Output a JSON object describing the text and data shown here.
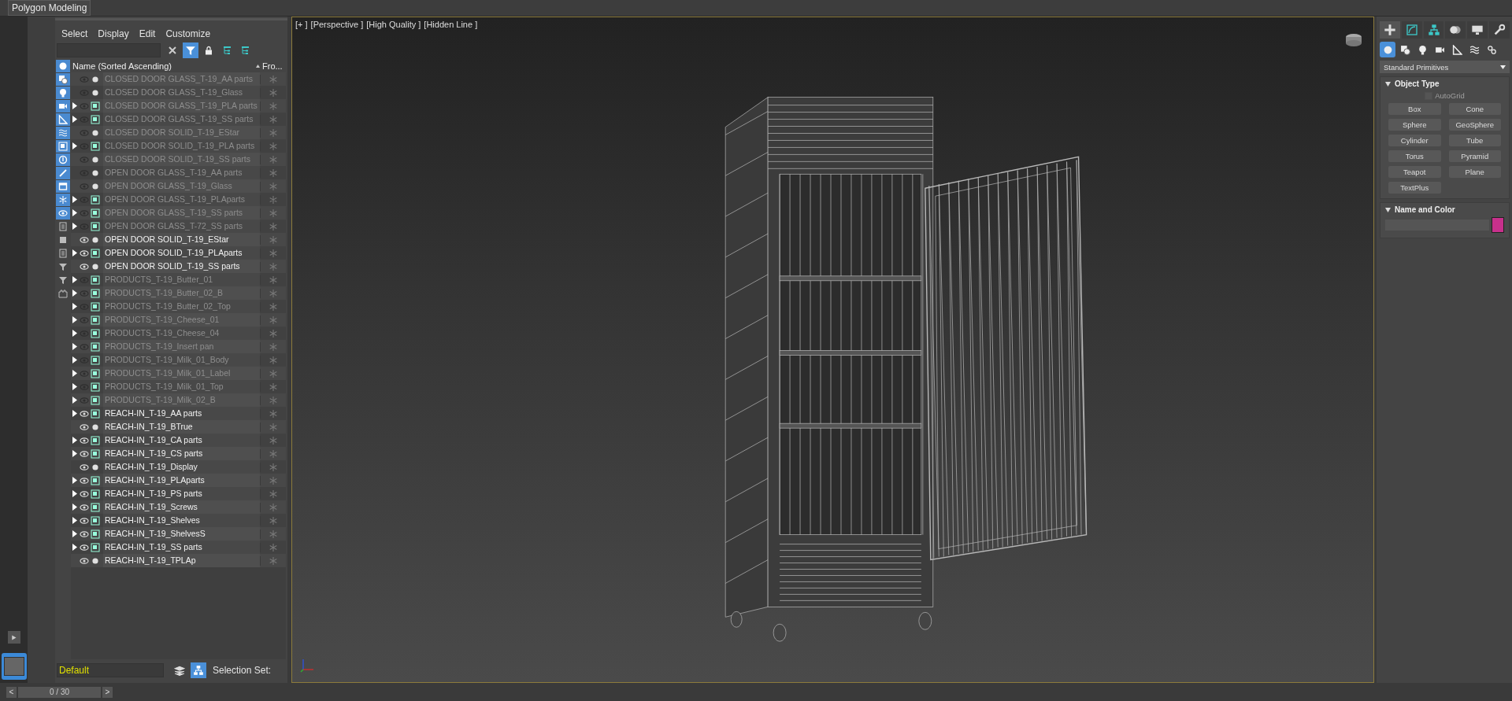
{
  "ribbon_tab": {
    "label": "Polygon Modeling"
  },
  "explorer": {
    "menu": [
      "Select",
      "Display",
      "Edit",
      "Customize"
    ],
    "filter_toggles": [
      {
        "on": true
      },
      {
        "on": true
      },
      {
        "on": true
      },
      {
        "on": true
      },
      {
        "on": true
      },
      {
        "on": true
      },
      {
        "on": true
      },
      {
        "on": true
      },
      {
        "on": true
      },
      {
        "on": true
      },
      {
        "on": true
      },
      {
        "on": true
      },
      {
        "on": false
      },
      {
        "on": false
      },
      {
        "on": false
      },
      {
        "on": false
      },
      {
        "on": false
      },
      {
        "on": false
      }
    ],
    "columns": [
      "Name (Sorted Ascending)",
      "Fro..."
    ],
    "rows": [
      {
        "name": "CLOSED DOOR GLASS_T-19_AA parts",
        "visible": false,
        "kind": "object",
        "expandable": false
      },
      {
        "name": "CLOSED DOOR GLASS_T-19_Glass",
        "visible": false,
        "kind": "object",
        "expandable": false
      },
      {
        "name": "CLOSED DOOR GLASS_T-19_PLA parts",
        "visible": false,
        "kind": "group",
        "expandable": true
      },
      {
        "name": "CLOSED DOOR GLASS_T-19_SS parts",
        "visible": false,
        "kind": "group",
        "expandable": true
      },
      {
        "name": "CLOSED DOOR SOLID_T-19_EStar",
        "visible": false,
        "kind": "object",
        "expandable": false
      },
      {
        "name": "CLOSED DOOR SOLID_T-19_PLA parts",
        "visible": false,
        "kind": "group",
        "expandable": true
      },
      {
        "name": "CLOSED DOOR SOLID_T-19_SS parts",
        "visible": false,
        "kind": "object",
        "expandable": false
      },
      {
        "name": "OPEN DOOR GLASS_T-19_AA parts",
        "visible": false,
        "kind": "object",
        "expandable": false
      },
      {
        "name": "OPEN DOOR GLASS_T-19_Glass",
        "visible": false,
        "kind": "object",
        "expandable": false
      },
      {
        "name": "OPEN DOOR GLASS_T-19_PLAparts",
        "visible": false,
        "kind": "group",
        "expandable": true
      },
      {
        "name": "OPEN DOOR GLASS_T-19_SS parts",
        "visible": false,
        "kind": "group",
        "expandable": true
      },
      {
        "name": "OPEN DOOR GLASS_T-72_SS parts",
        "visible": false,
        "kind": "group",
        "expandable": true
      },
      {
        "name": "OPEN DOOR SOLID_T-19_EStar",
        "visible": true,
        "kind": "object",
        "expandable": false
      },
      {
        "name": "OPEN DOOR SOLID_T-19_PLAparts",
        "visible": true,
        "kind": "group",
        "expandable": true
      },
      {
        "name": "OPEN DOOR SOLID_T-19_SS parts",
        "visible": true,
        "kind": "object",
        "expandable": false
      },
      {
        "name": "PRODUCTS_T-19_Butter_01",
        "visible": false,
        "kind": "group",
        "expandable": true
      },
      {
        "name": "PRODUCTS_T-19_Butter_02_B",
        "visible": false,
        "kind": "group",
        "expandable": true
      },
      {
        "name": "PRODUCTS_T-19_Butter_02_Top",
        "visible": false,
        "kind": "group",
        "expandable": true
      },
      {
        "name": "PRODUCTS_T-19_Cheese_01",
        "visible": false,
        "kind": "group",
        "expandable": true
      },
      {
        "name": "PRODUCTS_T-19_Cheese_04",
        "visible": false,
        "kind": "group",
        "expandable": true
      },
      {
        "name": "PRODUCTS_T-19_Insert pan",
        "visible": false,
        "kind": "group",
        "expandable": true
      },
      {
        "name": "PRODUCTS_T-19_Milk_01_Body",
        "visible": false,
        "kind": "group",
        "expandable": true
      },
      {
        "name": "PRODUCTS_T-19_Milk_01_Label",
        "visible": false,
        "kind": "group",
        "expandable": true
      },
      {
        "name": "PRODUCTS_T-19_Milk_01_Top",
        "visible": false,
        "kind": "group",
        "expandable": true
      },
      {
        "name": "PRODUCTS_T-19_Milk_02_B",
        "visible": false,
        "kind": "group",
        "expandable": true
      },
      {
        "name": "REACH-IN_T-19_AA parts",
        "visible": true,
        "kind": "group",
        "expandable": true
      },
      {
        "name": "REACH-IN_T-19_BTrue",
        "visible": true,
        "kind": "object",
        "expandable": false
      },
      {
        "name": "REACH-IN_T-19_CA parts",
        "visible": true,
        "kind": "group",
        "expandable": true
      },
      {
        "name": "REACH-IN_T-19_CS parts",
        "visible": true,
        "kind": "group",
        "expandable": true
      },
      {
        "name": "REACH-IN_T-19_Display",
        "visible": true,
        "kind": "object",
        "expandable": false
      },
      {
        "name": "REACH-IN_T-19_PLAparts",
        "visible": true,
        "kind": "group",
        "expandable": true
      },
      {
        "name": "REACH-IN_T-19_PS parts",
        "visible": true,
        "kind": "group",
        "expandable": true
      },
      {
        "name": "REACH-IN_T-19_Screws",
        "visible": true,
        "kind": "group",
        "expandable": true
      },
      {
        "name": "REACH-IN_T-19_Shelves",
        "visible": true,
        "kind": "group",
        "expandable": true
      },
      {
        "name": "REACH-IN_T-19_ShelvesS",
        "visible": true,
        "kind": "group",
        "expandable": true
      },
      {
        "name": "REACH-IN_T-19_SS parts",
        "visible": true,
        "kind": "group",
        "expandable": true
      },
      {
        "name": "REACH-IN_T-19_TPLAp",
        "visible": true,
        "kind": "object",
        "expandable": false
      }
    ],
    "layer": {
      "value": "Default"
    },
    "selection_set_label": "Selection Set:"
  },
  "timeline": {
    "prev": "<",
    "position": "0 / 30",
    "next": ">"
  },
  "viewport": {
    "labels": [
      "[+ ]",
      "[Perspective ]",
      "[High Quality ]",
      "[Hidden Line ]"
    ]
  },
  "command_panel": {
    "tabs": [
      {
        "selected": true
      },
      {
        "selected": false
      },
      {
        "selected": false
      },
      {
        "selected": false
      },
      {
        "selected": false
      },
      {
        "selected": false
      }
    ],
    "categories": [
      {
        "selected": true
      },
      {
        "selected": false
      },
      {
        "selected": false
      },
      {
        "selected": false
      },
      {
        "selected": false
      },
      {
        "selected": false
      },
      {
        "selected": false
      }
    ],
    "dropdown": "Standard Primitives",
    "object_type": {
      "title": "Object Type",
      "autogrid": {
        "label": "AutoGrid",
        "checked": false,
        "disabled": true
      },
      "buttons": [
        "Box",
        "Cone",
        "Sphere",
        "GeoSphere",
        "Cylinder",
        "Tube",
        "Torus",
        "Pyramid",
        "Teapot",
        "Plane",
        "TextPlus"
      ]
    },
    "name_and_color": {
      "title": "Name and Color",
      "color": "#c8308c"
    }
  }
}
